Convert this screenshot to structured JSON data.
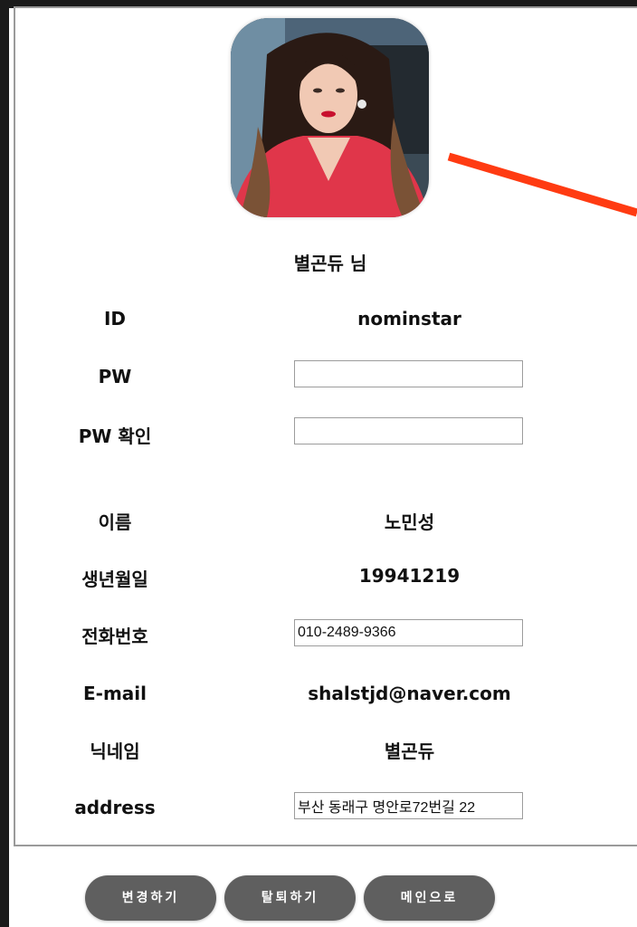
{
  "profile": {
    "greeting": "별곤듀 님"
  },
  "fields": {
    "id": {
      "label": "ID",
      "value": "nominstar"
    },
    "pw": {
      "label": "PW",
      "value": ""
    },
    "pw_confirm": {
      "label": "PW 확인",
      "value": ""
    },
    "name": {
      "label": "이름",
      "value": "노민성"
    },
    "birth": {
      "label": "생년월일",
      "value": "19941219"
    },
    "phone": {
      "label": "전화번호",
      "value": "010-2489-9366"
    },
    "email": {
      "label": "E-mail",
      "value": "shalstjd@naver.com"
    },
    "nickname": {
      "label": "닉네임",
      "value": "별곤듀"
    },
    "address": {
      "label": "address",
      "value": "부산 동래구 명안로72번길 22"
    }
  },
  "buttons": {
    "edit": "변경하기",
    "withdraw": "탈퇴하기",
    "main": "메인으로"
  },
  "colors": {
    "button_bg": "#5f5f5f",
    "arrow": "#ff3b12",
    "card_border": "#9a9a9a"
  },
  "icons": {
    "arrow": "red-arrow-annotation"
  }
}
